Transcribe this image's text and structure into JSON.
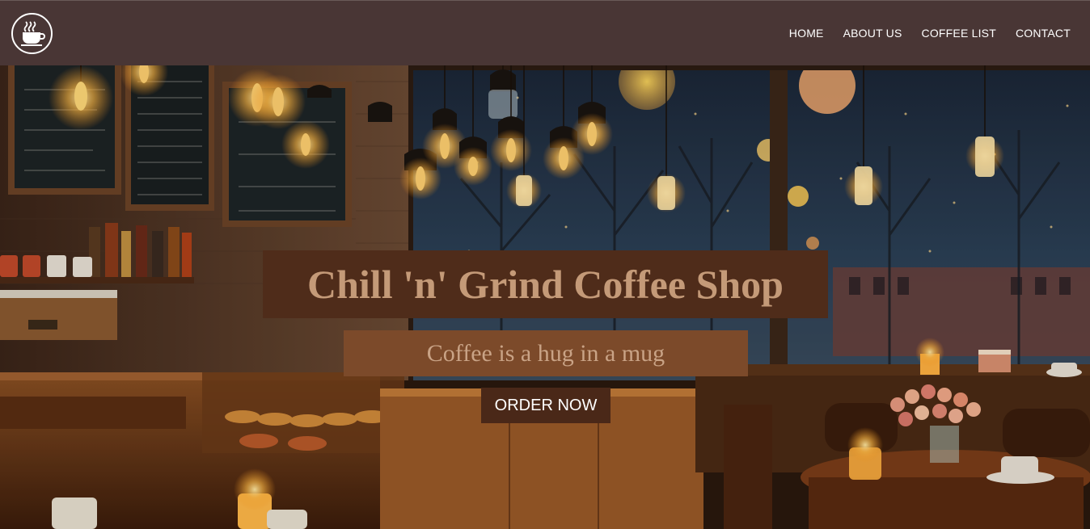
{
  "navbar": {
    "logo_icon": "coffee-cup-icon",
    "links": [
      {
        "label": "HOME"
      },
      {
        "label": "ABOUT US"
      },
      {
        "label": "COFFEE LIST"
      },
      {
        "label": "CONTACT"
      }
    ]
  },
  "hero": {
    "title": "Chill 'n' Grind Coffee Shop",
    "tagline": "Coffee is a hug in a mug",
    "cta_label": "ORDER NOW"
  },
  "colors": {
    "navbar_bg": "#493635",
    "title_bg": "#4f2c1a",
    "title_text": "#c49a78",
    "tagline_bg": "#7c4a2a",
    "tagline_text": "#c9a386",
    "button_bg": "#4a2818"
  }
}
